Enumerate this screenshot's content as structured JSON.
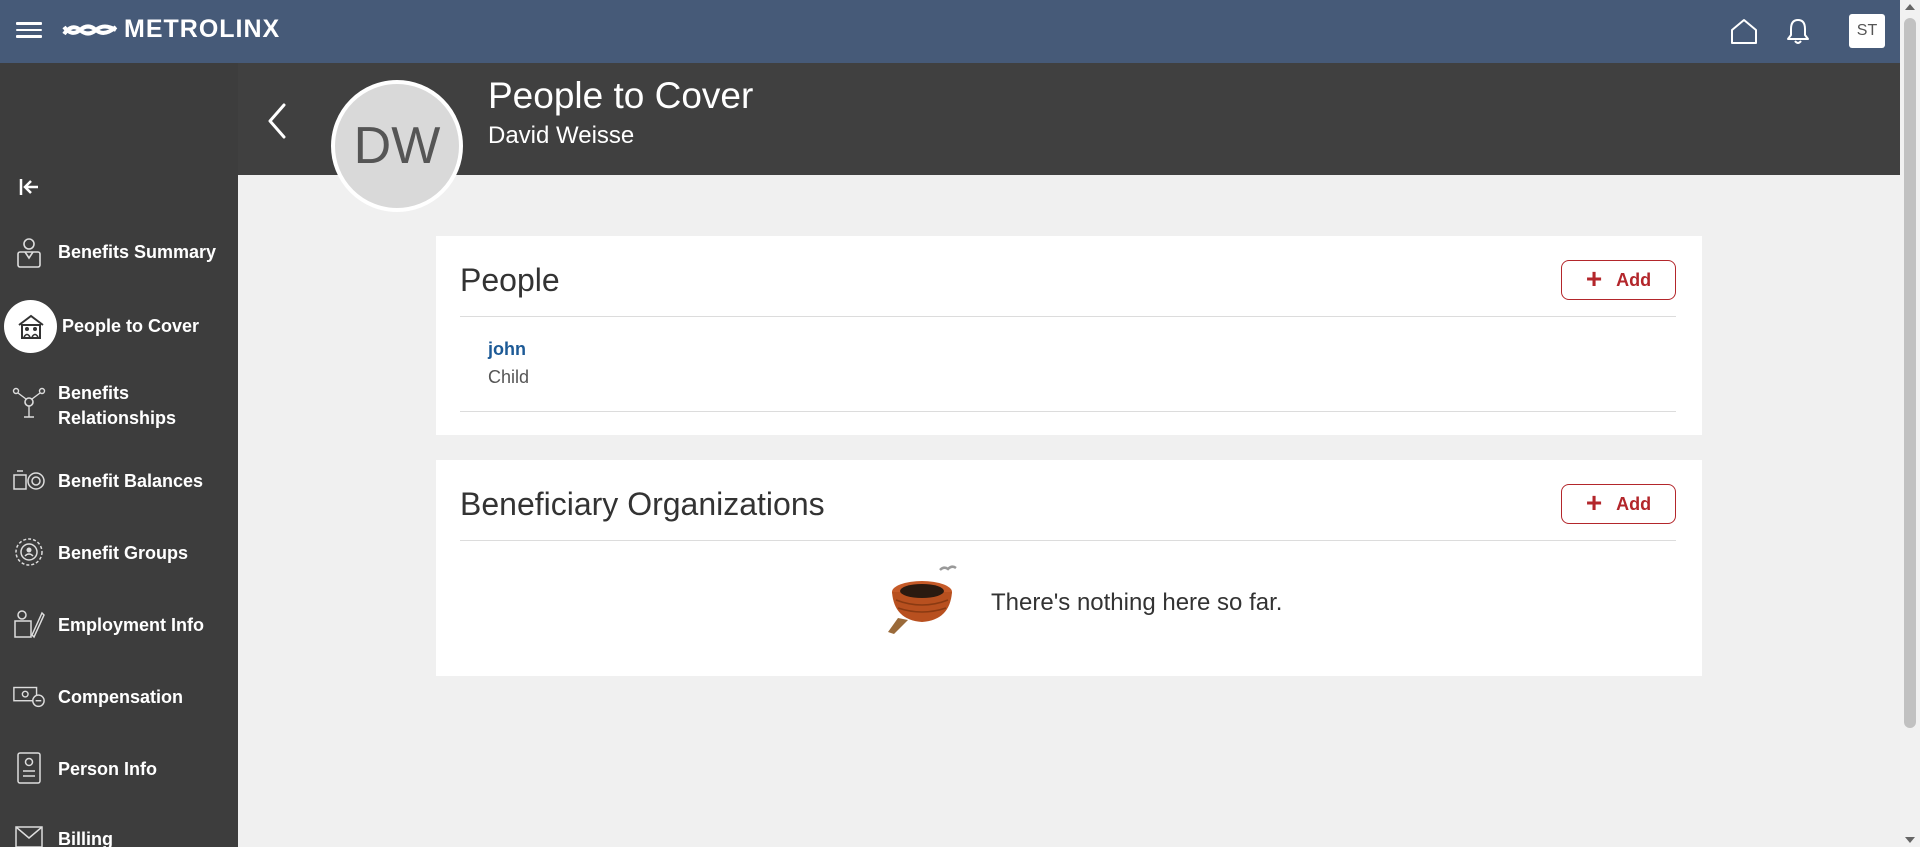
{
  "brand": {
    "name": "METROLINX"
  },
  "topbar": {
    "home_icon": "home-icon",
    "bell_icon": "bell-icon",
    "user_initials": "ST"
  },
  "sidebar": {
    "items": [
      {
        "label": "Benefits Summary",
        "icon": "person-summary-icon"
      },
      {
        "label": "People to Cover",
        "icon": "house-people-icon",
        "active": true
      },
      {
        "label": "Benefits Relationships",
        "icon": "relationship-icon"
      },
      {
        "label": "Benefit Balances",
        "icon": "balances-icon"
      },
      {
        "label": "Benefit Groups",
        "icon": "groups-icon"
      },
      {
        "label": "Employment Info",
        "icon": "employment-icon"
      },
      {
        "label": "Compensation",
        "icon": "compensation-icon"
      },
      {
        "label": "Person Info",
        "icon": "person-info-icon"
      },
      {
        "label": "Billing",
        "icon": "billing-icon"
      }
    ]
  },
  "header": {
    "title": "People to Cover",
    "subtitle": "David Weisse",
    "avatar_initials": "DW"
  },
  "people_card": {
    "title": "People",
    "add_label": "Add",
    "people": [
      {
        "name": "john",
        "relationship": "Child"
      }
    ]
  },
  "orgs_card": {
    "title": "Beneficiary Organizations",
    "add_label": "Add",
    "empty_message": "There's nothing here so far."
  },
  "colors": {
    "topbar": "#465a78",
    "sidebar": "#3d3d3d",
    "header": "#404040",
    "accent_red": "#b3262b",
    "link_blue": "#1d5a96"
  }
}
